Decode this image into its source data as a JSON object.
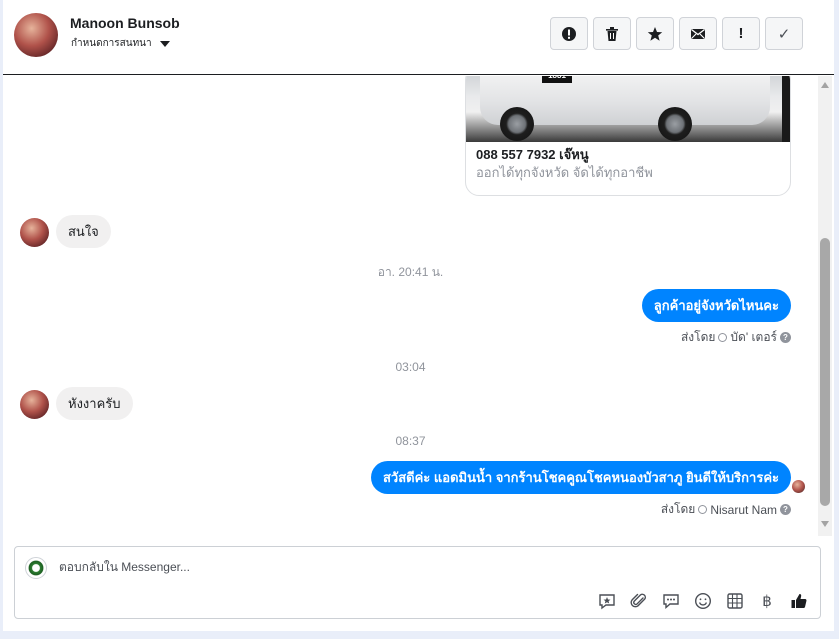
{
  "header": {
    "contact_name": "Manoon Bunsob",
    "settings_label": "กำหนดการสนทนา",
    "toolbar": [
      {
        "name": "alert-circle-button",
        "icon": "alert-circle-icon"
      },
      {
        "name": "delete-button",
        "icon": "trash-icon"
      },
      {
        "name": "star-button",
        "icon": "star-icon"
      },
      {
        "name": "mark-unread-button",
        "icon": "envelope-icon"
      },
      {
        "name": "important-button",
        "icon": "exclamation-icon",
        "glyph": "!"
      },
      {
        "name": "mark-done-button",
        "icon": "checkmark-icon",
        "glyph": "✓"
      }
    ]
  },
  "card": {
    "plate": "1881",
    "title": "088 557 7932 เจ๊หนู",
    "subtitle": "ออกได้ทุกจังหวัด จัดได้ทุกอาชีพ"
  },
  "messages": {
    "m1": "สนใจ",
    "ts1": "อา. 20:41 น.",
    "m2": "ลูกค้าอยู่จังหวัดไหนคะ",
    "sent_by_label_1": "ส่งโดย",
    "sender_1": "บัด' เตอร์",
    "ts2": "03:04",
    "m3": "หังงาครับ",
    "ts3": "08:37",
    "m4": "สวัสดีค่ะ แอดมินน้ำ จากร้านโชคคูณโชคหนองบัวสาภู ยินดีให้บริการค่ะ",
    "sent_by_label_2": "ส่งโดย",
    "sender_2": "Nisarut Nam"
  },
  "composer": {
    "placeholder": "ตอบกลับใน Messenger...",
    "icons": [
      "saved-reply-icon",
      "attachment-icon",
      "chat-bubble-icon",
      "emoji-icon",
      "table-icon",
      "baht-icon",
      "thumbs-up-icon"
    ],
    "baht_glyph": "฿"
  },
  "colors": {
    "accent": "#0084ff",
    "incoming_bubble": "#f1f0f0",
    "muted_text": "#90949c"
  }
}
